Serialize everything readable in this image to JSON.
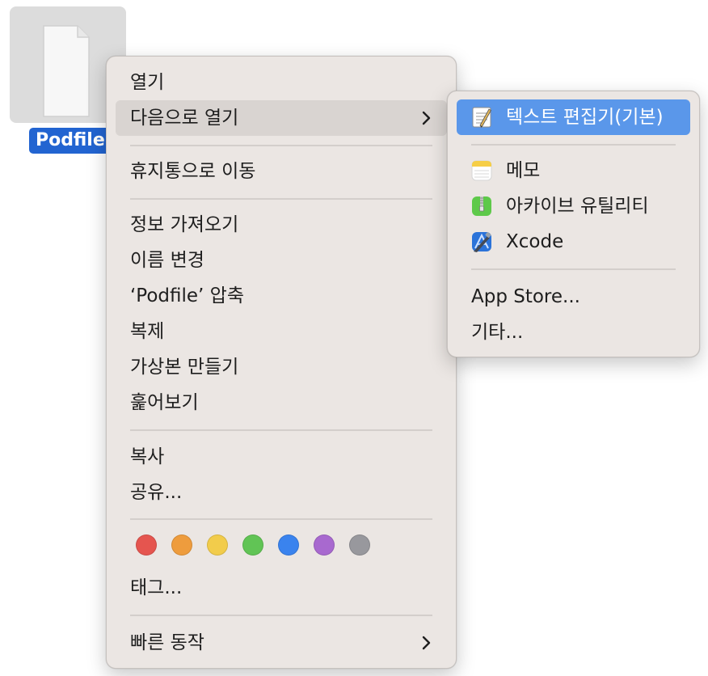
{
  "desktop": {
    "file_name": "Podfile",
    "icon": "document-icon"
  },
  "context_menu": {
    "open": "열기",
    "open_with": "다음으로 열기",
    "move_to_trash": "휴지통으로 이동",
    "get_info": "정보 가져오기",
    "rename": "이름 변경",
    "compress": "‘Podfile’ 압축",
    "duplicate": "복제",
    "make_alias": "가상본 만들기",
    "quick_look": "훑어보기",
    "copy": "복사",
    "share": "공유...",
    "tags_label": "태그...",
    "quick_actions": "빠른 동작",
    "tag_colors": [
      {
        "name": "red",
        "color": "#e5554f"
      },
      {
        "name": "orange",
        "color": "#ee9c3d"
      },
      {
        "name": "yellow",
        "color": "#f2cc4b"
      },
      {
        "name": "green",
        "color": "#61c455"
      },
      {
        "name": "blue",
        "color": "#3a83ee"
      },
      {
        "name": "purple",
        "color": "#a869cf"
      },
      {
        "name": "gray",
        "color": "#98989d"
      }
    ]
  },
  "open_with_submenu": {
    "default_app": "텍스트 편집기(기본)",
    "apps": [
      {
        "label": "메모",
        "icon": "notes-icon"
      },
      {
        "label": "아카이브 유틸리티",
        "icon": "archive-utility-icon"
      },
      {
        "label": "Xcode",
        "icon": "xcode-icon"
      }
    ],
    "app_store": "App Store...",
    "other": "기타..."
  },
  "colors": {
    "selection": "#5a97ea",
    "file_label_bg": "#2264d1",
    "menu_bg": "#ebe6e3"
  }
}
